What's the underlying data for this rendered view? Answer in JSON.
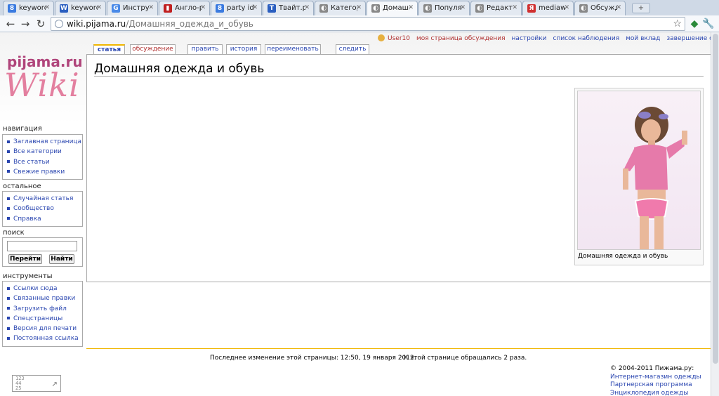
{
  "browser": {
    "tabs": [
      {
        "title": "keyword",
        "color": "#3b7be0",
        "glyph": "8"
      },
      {
        "title": "keyword",
        "color": "#2b5fc0",
        "glyph": "W"
      },
      {
        "title": "Инстру",
        "color": "#4a8ae8",
        "glyph": "G"
      },
      {
        "title": "Англо-р",
        "color": "#c02020",
        "glyph": "▮"
      },
      {
        "title": "party id",
        "color": "#3b7be0",
        "glyph": "8"
      },
      {
        "title": "Твайт.р",
        "color": "#2b5fc0",
        "glyph": "T"
      },
      {
        "title": "Категор",
        "color": "#888888",
        "glyph": "◐"
      },
      {
        "title": "Домашн",
        "color": "#888888",
        "glyph": "◐"
      },
      {
        "title": "Популя",
        "color": "#888888",
        "glyph": "◐"
      },
      {
        "title": "Редакти",
        "color": "#888888",
        "glyph": "◐"
      },
      {
        "title": "mediawi",
        "color": "#d03030",
        "glyph": "Я"
      },
      {
        "title": "Обсужд",
        "color": "#888888",
        "glyph": "◐"
      }
    ],
    "active_tab": 7,
    "address": {
      "host": "wiki.pijama.ru",
      "path": "/Домашняя_одежда_и_обувь"
    },
    "icons": {
      "back": "back-arrow-icon",
      "forward": "forward-arrow-icon",
      "reload": "reload-icon",
      "bookmark": "star-icon",
      "settings": "wrench-icon"
    }
  },
  "logo": {
    "brand_text": "pijama",
    "brand_tld": ".ru",
    "script_text": "Wiki"
  },
  "personal": {
    "user": "User10",
    "links": [
      "моя страница обсуждения",
      "настройки",
      "список наблюдения",
      "мой вклад",
      "завершение сеанса"
    ]
  },
  "page_tabs": [
    {
      "label": "статья"
    },
    {
      "label": "обсуждение"
    },
    {
      "label": "править"
    },
    {
      "label": "история"
    },
    {
      "label": "переименовать"
    },
    {
      "label": "следить"
    }
  ],
  "content": {
    "title": "Домашняя одежда и обувь",
    "thumb_caption": "Домашняя одежда и обувь"
  },
  "sidebar": {
    "navigation": {
      "title": "навигация",
      "items": [
        "Заглавная страница",
        "Все категории",
        "Все статьи",
        "Свежие правки"
      ]
    },
    "other": {
      "title": "остальное",
      "items": [
        "Случайная статья",
        "Сообщество",
        "Справка"
      ]
    },
    "search": {
      "title": "поиск",
      "go_label": "Перейти",
      "find_label": "Найти"
    },
    "tools": {
      "title": "инструменты",
      "items": [
        "Ссылки сюда",
        "Связанные правки",
        "Загрузить файл",
        "Спецстраницы",
        "Версия для печати",
        "Постоянная ссылка"
      ]
    }
  },
  "footer": {
    "last_modified": "Последнее изменение этой страницы: 12:50, 19 января 2012.",
    "views": "К этой странице обращались 2 раза.",
    "copyright": "© 2004-2011 Пижама.ру:",
    "links": [
      "Интернет-магазин одежды",
      "Партнерская программа",
      "Энциклопедия одежды"
    ],
    "counter_lines": [
      "123",
      "44",
      "25"
    ]
  }
}
